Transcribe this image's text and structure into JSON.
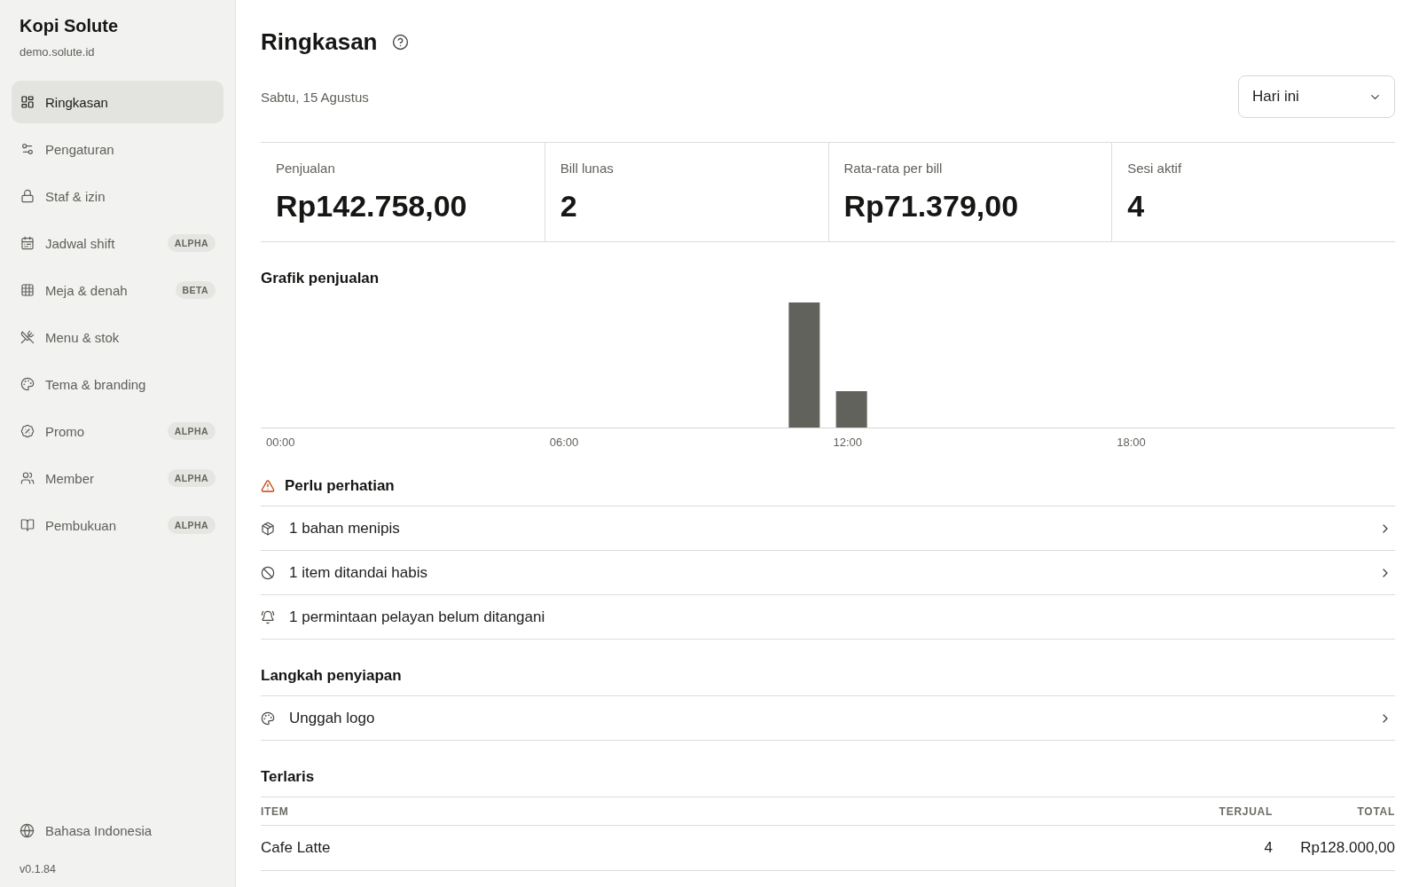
{
  "sidebar": {
    "brand": "Kopi Solute",
    "domain": "demo.solute.id",
    "items": [
      {
        "label": "Ringkasan",
        "selected": true
      },
      {
        "label": "Pengaturan",
        "selected": false
      },
      {
        "label": "Staf & izin",
        "selected": false
      },
      {
        "label": "Jadwal shift",
        "badge": "ALPHA",
        "selected": false
      },
      {
        "label": "Meja & denah",
        "badge": "BETA",
        "selected": false
      },
      {
        "label": "Menu & stok",
        "selected": false
      },
      {
        "label": "Tema & branding",
        "selected": false
      },
      {
        "label": "Promo",
        "badge": "ALPHA",
        "selected": false
      },
      {
        "label": "Member",
        "badge": "ALPHA",
        "selected": false
      },
      {
        "label": "Pembukuan",
        "badge": "ALPHA",
        "selected": false
      }
    ],
    "language": "Bahasa Indonesia",
    "version": "v0.1.84"
  },
  "page": {
    "title": "Ringkasan",
    "date": "Sabtu, 15 Agustus",
    "period_select": {
      "value": "Hari ini"
    }
  },
  "stats": [
    {
      "label": "Penjualan",
      "value": "Rp142.758,00"
    },
    {
      "label": "Bill lunas",
      "value": "2"
    },
    {
      "label": "Rata-rata per bill",
      "value": "Rp71.379,00"
    },
    {
      "label": "Sesi aktif",
      "value": "4"
    }
  ],
  "sales_chart": {
    "title": "Grafik penjualan",
    "x_labels": [
      "00:00",
      "06:00",
      "12:00",
      "18:00"
    ]
  },
  "attention": {
    "title": "Perlu perhatian",
    "items": [
      {
        "text": "1 bahan menipis",
        "navigable": true
      },
      {
        "text": "1 item ditandai habis",
        "navigable": true
      },
      {
        "text": "1 permintaan pelayan belum ditangani",
        "navigable": false
      }
    ]
  },
  "setup": {
    "title": "Langkah penyiapan",
    "items": [
      {
        "text": "Unggah logo",
        "navigable": true
      }
    ]
  },
  "top_sellers": {
    "title": "Terlaris",
    "columns": [
      "ITEM",
      "TERJUAL",
      "TOTAL"
    ],
    "rows": [
      [
        "Cafe Latte",
        "4",
        "Rp128.000,00"
      ]
    ]
  }
}
